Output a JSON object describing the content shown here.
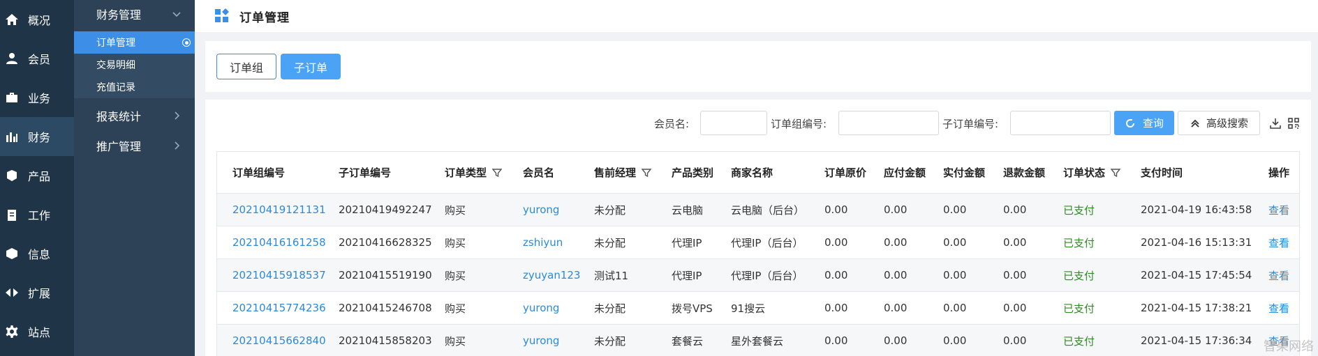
{
  "nav1": {
    "items": [
      {
        "label": "概况",
        "icon": "home-icon"
      },
      {
        "label": "会员",
        "icon": "user-icon"
      },
      {
        "label": "业务",
        "icon": "briefcase-icon"
      },
      {
        "label": "财务",
        "icon": "bar-chart-icon"
      },
      {
        "label": "产品",
        "icon": "cubes-icon"
      },
      {
        "label": "工作",
        "icon": "clipboard-icon"
      },
      {
        "label": "信息",
        "icon": "box-icon"
      },
      {
        "label": "扩展",
        "icon": "arrows-icon"
      },
      {
        "label": "站点",
        "icon": "gear-icon"
      }
    ]
  },
  "nav2": {
    "finance": "财务管理",
    "sub": [
      "订单管理",
      "交易明细",
      "充值记录"
    ],
    "reports": "报表统计",
    "promo": "推广管理"
  },
  "header": {
    "title": "订单管理"
  },
  "tabs": {
    "group": "订单组",
    "sub": "子订单"
  },
  "search": {
    "member_label": "会员名:",
    "group_no_label": "订单组编号:",
    "sub_no_label": "子订单编号:",
    "query": "查询",
    "advanced": "高级搜索"
  },
  "table": {
    "headers": [
      "订单组编号",
      "子订单编号",
      "订单类型",
      "会员名",
      "售前经理",
      "产品类别",
      "商家名称",
      "订单原价",
      "应付金额",
      "实付金额",
      "退款金额",
      "订单状态",
      "支付时间",
      "操作"
    ],
    "rows": [
      [
        "20210419121131",
        "20210419492247",
        "购买",
        "yurong",
        "未分配",
        "云电脑",
        "云电脑（后台）",
        "0.00",
        "0.00",
        "0.00",
        "0.00",
        "已支付",
        "2021-04-19 16:43:58",
        "查看"
      ],
      [
        "20210416161258",
        "20210416628325",
        "购买",
        "zshiyun",
        "未分配",
        "代理IP",
        "代理IP（后台）",
        "0.00",
        "0.00",
        "0.00",
        "0.00",
        "已支付",
        "2021-04-16 15:13:31",
        "查看"
      ],
      [
        "20210415918537",
        "20210415519190",
        "购买",
        "zyuyan123",
        "测试11",
        "代理IP",
        "代理IP（后台）",
        "0.00",
        "0.00",
        "0.00",
        "0.00",
        "已支付",
        "2021-04-15 17:45:54",
        "查看"
      ],
      [
        "20210415774236",
        "20210415246708",
        "购买",
        "yurong",
        "未分配",
        "拨号VPS",
        "91搜云",
        "0.00",
        "0.00",
        "0.00",
        "0.00",
        "已支付",
        "2021-04-15 17:38:21",
        "查看"
      ],
      [
        "20210415662840",
        "20210415858203",
        "购买",
        "yurong",
        "未分配",
        "套餐云",
        "星外套餐云",
        "0.00",
        "0.00",
        "0.00",
        "0.00",
        "已支付",
        "2021-04-15 17:36:34",
        "查看"
      ]
    ]
  },
  "watermark": "智果网络"
}
